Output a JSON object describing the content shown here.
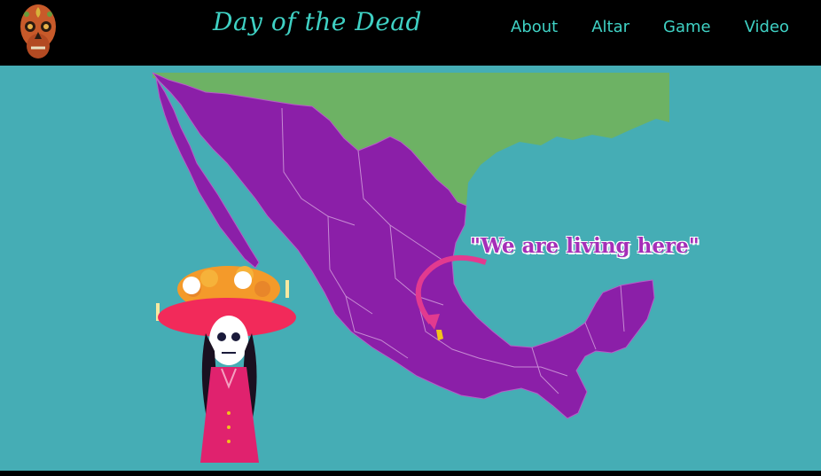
{
  "site": {
    "title": "Day of the Dead"
  },
  "nav": {
    "items": [
      {
        "label": "About"
      },
      {
        "label": "Altar"
      },
      {
        "label": "Game"
      },
      {
        "label": "Video"
      }
    ]
  },
  "map": {
    "caption": "\"We are living here\"",
    "colors": {
      "sea": "#45adb5",
      "land_us": "#6db264",
      "land_mexico": "#8b1fa8",
      "accent": "#e23a8f",
      "marker": "#f2c21b"
    }
  },
  "icons": {
    "logo": "sugar-skull-icon",
    "arrow": "curved-arrow-icon",
    "figure": "catrina-illustration"
  },
  "theme": {
    "header_bg": "#000000",
    "nav_color": "#3fd1c4"
  }
}
